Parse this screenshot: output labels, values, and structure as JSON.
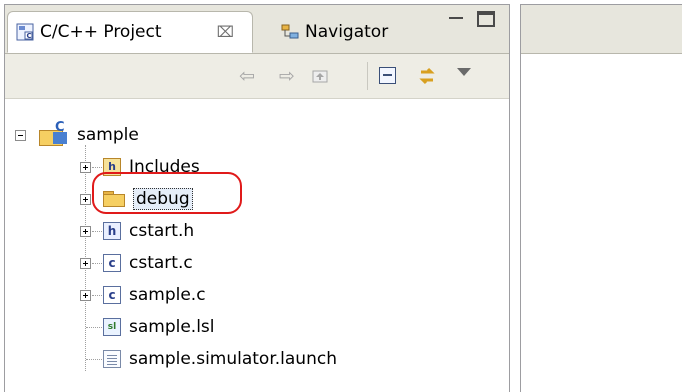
{
  "tabs": {
    "active_label": "C/C++ Project",
    "close_glyph": "⌧",
    "inactive_label": "Navigator"
  },
  "icons": {
    "back": "⇦",
    "forward": "⇨",
    "link": "⇄"
  },
  "tree": {
    "project": "sample",
    "items": [
      {
        "label": "Includes",
        "icon": "includes-icon"
      },
      {
        "label": "debug",
        "icon": "folder-icon"
      },
      {
        "label": "cstart.h",
        "icon": "h-file-icon",
        "glyph": "h"
      },
      {
        "label": "cstart.c",
        "icon": "c-file-icon",
        "glyph": "c"
      },
      {
        "label": "sample.c",
        "icon": "c-file-icon",
        "glyph": "c"
      },
      {
        "label": "sample.lsl",
        "icon": "lsl-file-icon",
        "glyph": "sl"
      },
      {
        "label": "sample.simulator.launch",
        "icon": "launch-file-icon"
      }
    ]
  },
  "highlight_color": "#e01a1a"
}
